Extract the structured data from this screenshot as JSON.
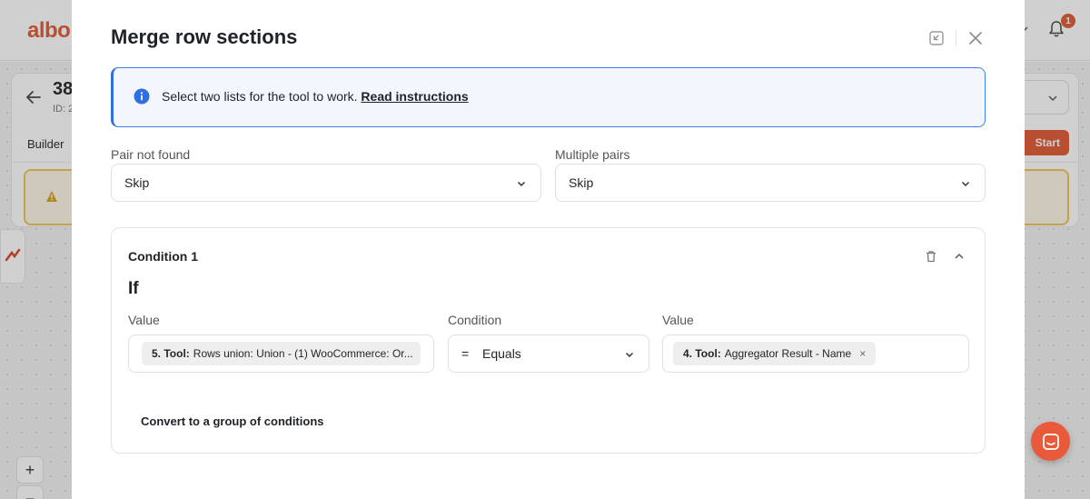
{
  "background": {
    "logo": "albo",
    "id_number": "38",
    "id_label": "ID: 2",
    "builder_tab": "Builder",
    "start_button": "Start",
    "notification_count": "1",
    "zoom_in": "+",
    "zoom_out": "−",
    "accent_color": "#e05a33"
  },
  "modal": {
    "title": "Merge row sections",
    "info": {
      "text": "Select two lists for the tool to work. ",
      "link": "Read instructions",
      "icon": "info-icon"
    },
    "pair_not_found": {
      "label": "Pair not found",
      "value": "Skip"
    },
    "multiple_pairs": {
      "label": "Multiple pairs",
      "value": "Skip"
    },
    "condition": {
      "title": "Condition 1",
      "if_label": "If",
      "left": {
        "label": "Value",
        "chip_bold": "5. Tool:",
        "chip_text": "Rows union: Union - (1) WooCommerce: Or..."
      },
      "operator": {
        "label": "Condition",
        "symbol": "=",
        "value": "Equals"
      },
      "right": {
        "label": "Value",
        "chip_bold": "4. Tool:",
        "chip_text": "Aggregator Result - Name",
        "remove": "×"
      },
      "convert_link": "Convert to a group of conditions"
    }
  }
}
